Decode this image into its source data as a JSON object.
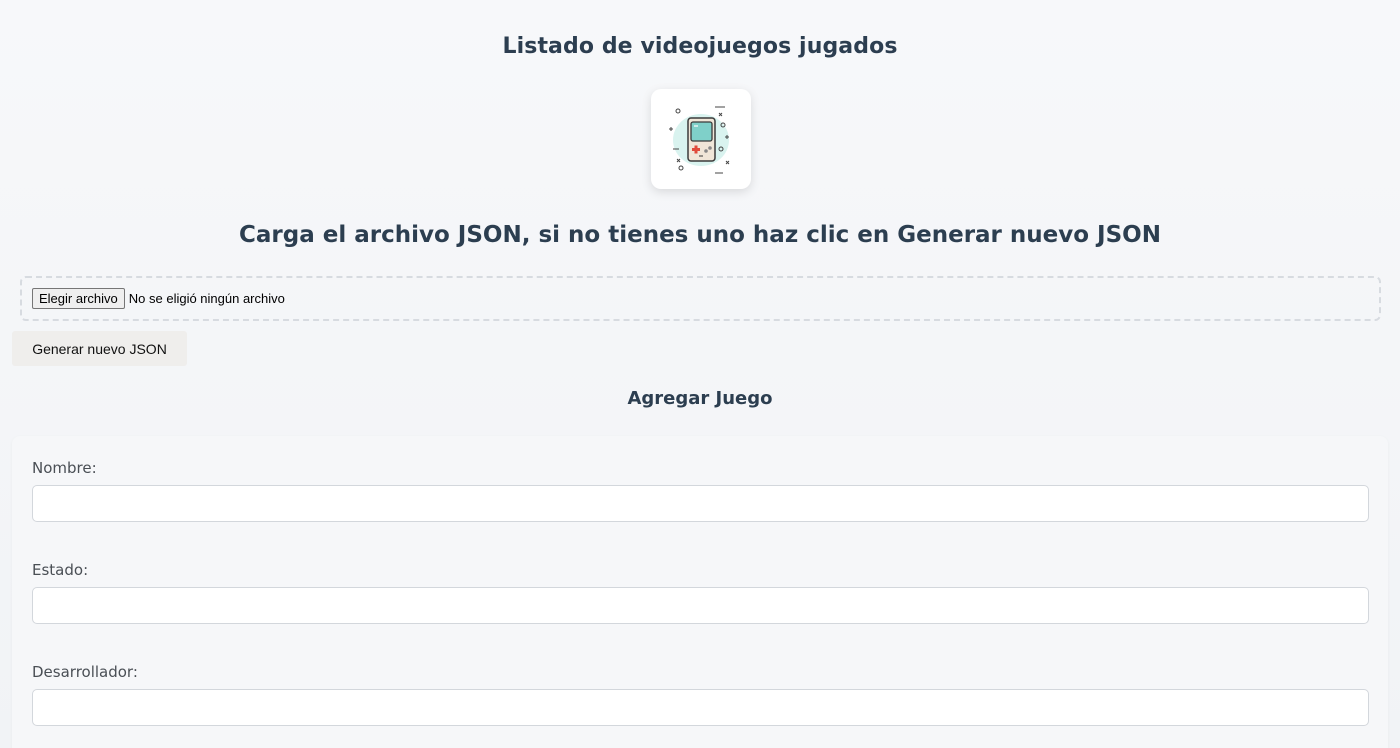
{
  "header": {
    "title": "Listado de videojuegos jugados",
    "logo_icon": "handheld-console-icon"
  },
  "upload": {
    "instruction": "Carga el archivo JSON, si no tienes uno haz clic en Generar nuevo JSON",
    "choose_file_label": "Elegir archivo",
    "file_status": "No se eligió ningún archivo",
    "generate_label": "Generar nuevo JSON"
  },
  "form": {
    "title": "Agregar Juego",
    "fields": [
      {
        "label": "Nombre:",
        "value": "",
        "placeholder": ""
      },
      {
        "label": "Estado:",
        "value": "",
        "placeholder": ""
      },
      {
        "label": "Desarrollador:",
        "value": "",
        "placeholder": ""
      }
    ]
  },
  "colors": {
    "heading": "#2c3e50",
    "background": "#f4f5f8",
    "panel": "#f6f7f9",
    "console_body": "#f0e6d8",
    "console_screen": "#7fd0c9",
    "dpad": "#e04b3c"
  }
}
